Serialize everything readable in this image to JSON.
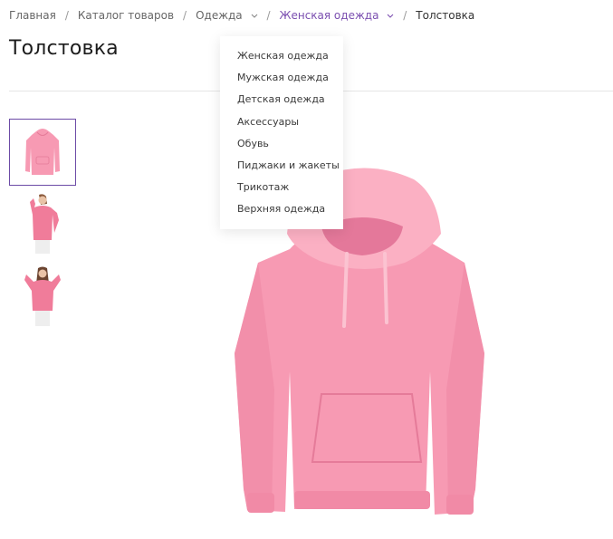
{
  "breadcrumb": {
    "items": [
      "Главная",
      "Каталог товаров",
      "Одежда",
      "Женская одежда"
    ],
    "current": "Толстовка"
  },
  "page": {
    "title": "Толстовка"
  },
  "category_menu": {
    "items": [
      "Женская одежда",
      "Мужская одежда",
      "Детская одежда",
      "Аксессуары",
      "Обувь",
      "Пиджаки и жакеты",
      "Трикотаж",
      "Верхняя одежда"
    ]
  },
  "colors": {
    "accent": "#6c4ba6",
    "hoodie": "#f79ab3",
    "hoodie_shade": "#ea7f9c",
    "hoodie_light": "#fbb7c8"
  }
}
